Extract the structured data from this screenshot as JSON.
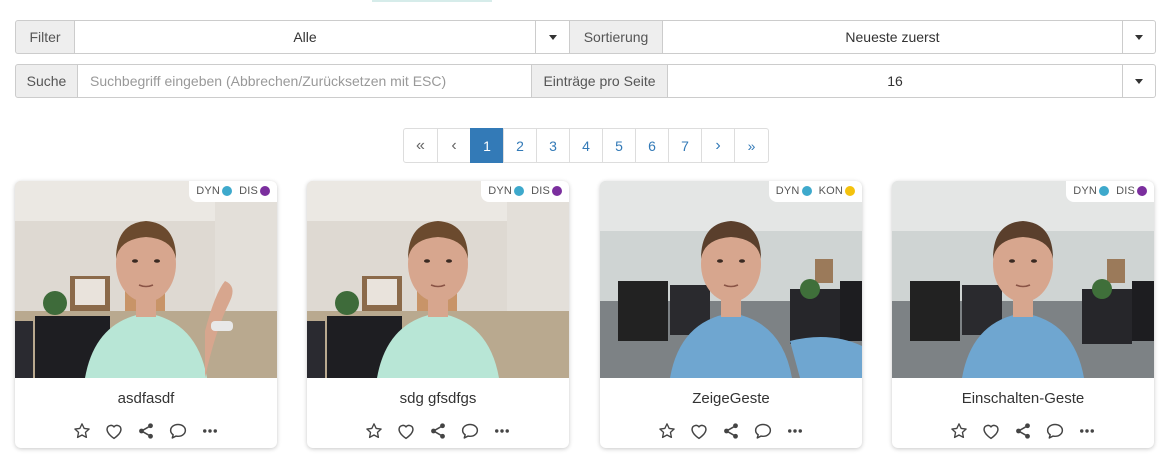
{
  "filters": {
    "filter_label": "Filter",
    "filter_value": "Alle",
    "sort_label": "Sortierung",
    "sort_value": "Neueste zuerst",
    "search_label": "Suche",
    "search_placeholder": "Suchbegriff eingeben (Abbrechen/Zurücksetzen mit ESC)",
    "per_page_label": "Einträge pro Seite",
    "per_page_value": "16"
  },
  "pagination": {
    "first": "«",
    "prev": "‹",
    "pages": [
      "1",
      "2",
      "3",
      "4",
      "5",
      "6",
      "7"
    ],
    "active_page": "1",
    "next": "›",
    "last": "»"
  },
  "colors": {
    "dyn": "#3ea9cc",
    "dis": "#7b2f9e",
    "kon": "#f4c20d",
    "active_page": "#337ab7"
  },
  "cards": [
    {
      "title": "asdfasdf",
      "badges": [
        {
          "label": "DYN",
          "color_key": "dyn"
        },
        {
          "label": "DIS",
          "color_key": "dis"
        }
      ],
      "shirt": "#b8e6d6",
      "scene": "office-light"
    },
    {
      "title": "sdg gfsdfgs",
      "badges": [
        {
          "label": "DYN",
          "color_key": "dyn"
        },
        {
          "label": "DIS",
          "color_key": "dis"
        }
      ],
      "shirt": "#b8e6d6",
      "scene": "office-light"
    },
    {
      "title": "ZeigeGeste",
      "badges": [
        {
          "label": "DYN",
          "color_key": "dyn"
        },
        {
          "label": "KON",
          "color_key": "kon"
        }
      ],
      "shirt": "#6fa6d0",
      "scene": "office-chairs"
    },
    {
      "title": "Einschalten-Geste",
      "badges": [
        {
          "label": "DYN",
          "color_key": "dyn"
        },
        {
          "label": "DIS",
          "color_key": "dis"
        }
      ],
      "shirt": "#6fa6d0",
      "scene": "office-chairs"
    }
  ],
  "card_actions": [
    "star-icon",
    "heart-icon",
    "share-icon",
    "comment-icon",
    "more-icon"
  ]
}
